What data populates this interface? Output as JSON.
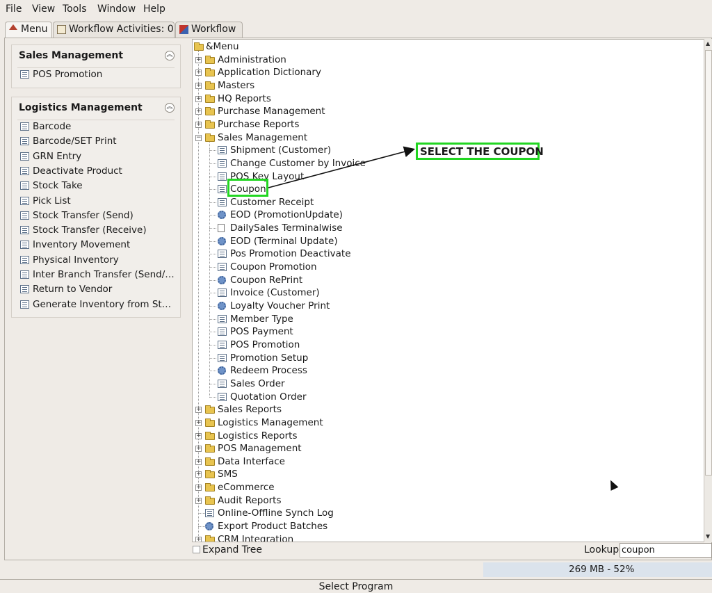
{
  "menubar": {
    "file": "File",
    "view": "View",
    "tools": "Tools",
    "window": "Window",
    "help": "Help"
  },
  "tabs": [
    {
      "label": "Menu"
    },
    {
      "label": "Workflow Activities: 0"
    },
    {
      "label": "Workflow"
    }
  ],
  "panels": {
    "sales": {
      "title": "Sales Management",
      "items": [
        "POS Promotion"
      ]
    },
    "logistics": {
      "title": "Logistics Management",
      "items": [
        "Barcode",
        "Barcode/SET Print",
        "GRN Entry",
        "Deactivate Product",
        "Stock Take",
        "Pick List",
        "Stock Transfer (Send)",
        "Stock Transfer (Receive)",
        "Inventory Movement",
        "Physical Inventory",
        "Inter Branch Transfer (Send/…",
        "Return to Vendor",
        "Generate Inventory from St…"
      ]
    }
  },
  "tree": {
    "root": "&Menu",
    "top_before": [
      "Administration",
      "Application Dictionary",
      "Masters",
      "HQ Reports",
      "Purchase Management",
      "Purchase Reports"
    ],
    "sales_folder": "Sales Management",
    "sales_children": [
      {
        "label": "Shipment (Customer)",
        "icon": "window"
      },
      {
        "label": "Change Customer by Invoice",
        "icon": "window"
      },
      {
        "label": "POS Key Layout",
        "icon": "window"
      },
      {
        "label": "Coupon",
        "icon": "window"
      },
      {
        "label": "Customer Receipt",
        "icon": "window"
      },
      {
        "label": "EOD (PromotionUpdate)",
        "icon": "process"
      },
      {
        "label": "DailySales Terminalwise",
        "icon": "report"
      },
      {
        "label": "EOD (Terminal Update)",
        "icon": "process"
      },
      {
        "label": "Pos Promotion Deactivate",
        "icon": "window"
      },
      {
        "label": "Coupon Promotion",
        "icon": "window"
      },
      {
        "label": "Coupon RePrint",
        "icon": "process"
      },
      {
        "label": "Invoice (Customer)",
        "icon": "window"
      },
      {
        "label": "Loyalty Voucher Print",
        "icon": "process"
      },
      {
        "label": "Member Type",
        "icon": "window"
      },
      {
        "label": "POS Payment",
        "icon": "window"
      },
      {
        "label": "POS Promotion",
        "icon": "window"
      },
      {
        "label": "Promotion Setup",
        "icon": "window"
      },
      {
        "label": "Redeem Process",
        "icon": "process"
      },
      {
        "label": "Sales Order",
        "icon": "window"
      },
      {
        "label": "Quotation Order",
        "icon": "window"
      }
    ],
    "top_after": [
      {
        "label": "Sales Reports",
        "icon": "folder"
      },
      {
        "label": "Logistics Management",
        "icon": "folder"
      },
      {
        "label": "Logistics Reports",
        "icon": "folder"
      },
      {
        "label": "POS Management",
        "icon": "folder"
      },
      {
        "label": "Data Interface",
        "icon": "folder"
      },
      {
        "label": "SMS",
        "icon": "folder"
      },
      {
        "label": "eCommerce",
        "icon": "folder"
      },
      {
        "label": "Audit Reports",
        "icon": "folder"
      },
      {
        "label": "Online-Offline Synch Log",
        "icon": "window"
      },
      {
        "label": "Export Product Batches",
        "icon": "process"
      },
      {
        "label": "CRM Integration",
        "icon": "folder"
      }
    ]
  },
  "annotation": {
    "text": "SELECT THE COUPON",
    "color": "#22d622"
  },
  "bottom": {
    "expand_tree": "Expand Tree",
    "lookup_label": "Lookup",
    "lookup_value": "coupon",
    "memory": "269 MB - 52%"
  },
  "status": "Select Program"
}
